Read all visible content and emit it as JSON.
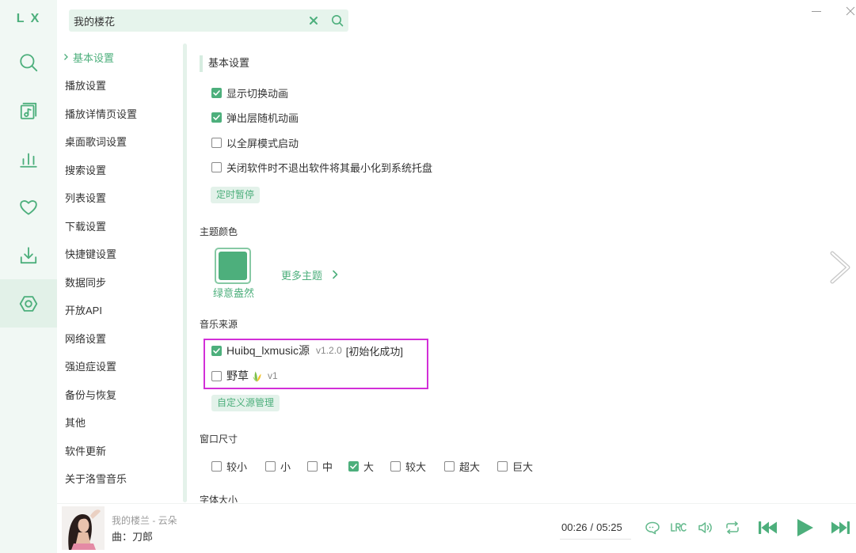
{
  "colors": {
    "primary": "#4daf7c",
    "primary_light": "#e3f2ea",
    "sidebar_bg": "#f1f8f4",
    "sidebar_active": "#e2f1e8",
    "highlight_border": "#d22fd8",
    "text": "#333333",
    "muted": "#999999"
  },
  "app": {
    "logo": "L X"
  },
  "window_controls": {
    "minimize_icon": "minimize-icon",
    "close_icon": "close-icon"
  },
  "search": {
    "value": "我的楼花",
    "clear_icon": "close-icon",
    "search_icon": "search-icon"
  },
  "sidebar": {
    "items": [
      {
        "icon": "search-icon",
        "active": false
      },
      {
        "icon": "music-file-icon",
        "active": false
      },
      {
        "icon": "bar-chart-icon",
        "active": false
      },
      {
        "icon": "heart-icon",
        "active": false
      },
      {
        "icon": "download-icon",
        "active": false
      },
      {
        "icon": "settings-icon",
        "active": true
      }
    ]
  },
  "nav": {
    "items": [
      {
        "label": "基本设置",
        "active": true
      },
      {
        "label": "播放设置",
        "active": false
      },
      {
        "label": "播放详情页设置",
        "active": false
      },
      {
        "label": "桌面歌词设置",
        "active": false
      },
      {
        "label": "搜索设置",
        "active": false
      },
      {
        "label": "列表设置",
        "active": false
      },
      {
        "label": "下载设置",
        "active": false
      },
      {
        "label": "快捷键设置",
        "active": false
      },
      {
        "label": "数据同步",
        "active": false
      },
      {
        "label": "开放API",
        "active": false
      },
      {
        "label": "网络设置",
        "active": false
      },
      {
        "label": "强迫症设置",
        "active": false
      },
      {
        "label": "备份与恢复",
        "active": false
      },
      {
        "label": "其他",
        "active": false
      },
      {
        "label": "软件更新",
        "active": false
      },
      {
        "label": "关于洛雪音乐",
        "active": false
      }
    ]
  },
  "basic": {
    "title": "基本设置",
    "options": [
      {
        "label": "显示切换动画",
        "checked": true
      },
      {
        "label": "弹出层随机动画",
        "checked": true
      },
      {
        "label": "以全屏模式启动",
        "checked": false
      },
      {
        "label": "关闭软件时不退出软件将其最小化到系统托盘",
        "checked": false
      }
    ],
    "timer_button": "定时暂停"
  },
  "theme": {
    "title": "主题颜色",
    "current": {
      "name": "绿意盎然",
      "color": "#4daf7c"
    },
    "more_label": "更多主题",
    "more_icon": "chevron-right-icon"
  },
  "music_source": {
    "title": "音乐来源",
    "items": [
      {
        "name": "Huibq_lxmusic源",
        "version": "v1.2.0",
        "status": "[初始化成功]",
        "checked": true
      },
      {
        "name": "野草",
        "icon": "grass-icon",
        "version": "v1",
        "checked": false
      }
    ],
    "manage_button": "自定义源管理"
  },
  "window_size": {
    "title": "窗口尺寸",
    "options": [
      {
        "label": "较小",
        "checked": false
      },
      {
        "label": "小",
        "checked": false
      },
      {
        "label": "中",
        "checked": false
      },
      {
        "label": "大",
        "checked": true
      },
      {
        "label": "较大",
        "checked": false
      },
      {
        "label": "超大",
        "checked": false
      },
      {
        "label": "巨大",
        "checked": false
      }
    ]
  },
  "font_size": {
    "title": "字体大小"
  },
  "pager": {
    "next_icon": "chevron-right-large-icon"
  },
  "player": {
    "title": "我的楼兰 - 云朵",
    "composer": "曲：刀郎",
    "time_current": "00:26",
    "time_separator": "/",
    "time_total": "05:25",
    "controls": [
      "comment-icon",
      "lyrics-icon",
      "volume-icon",
      "repeat-icon",
      "previous-icon",
      "play-icon",
      "next-icon"
    ]
  }
}
